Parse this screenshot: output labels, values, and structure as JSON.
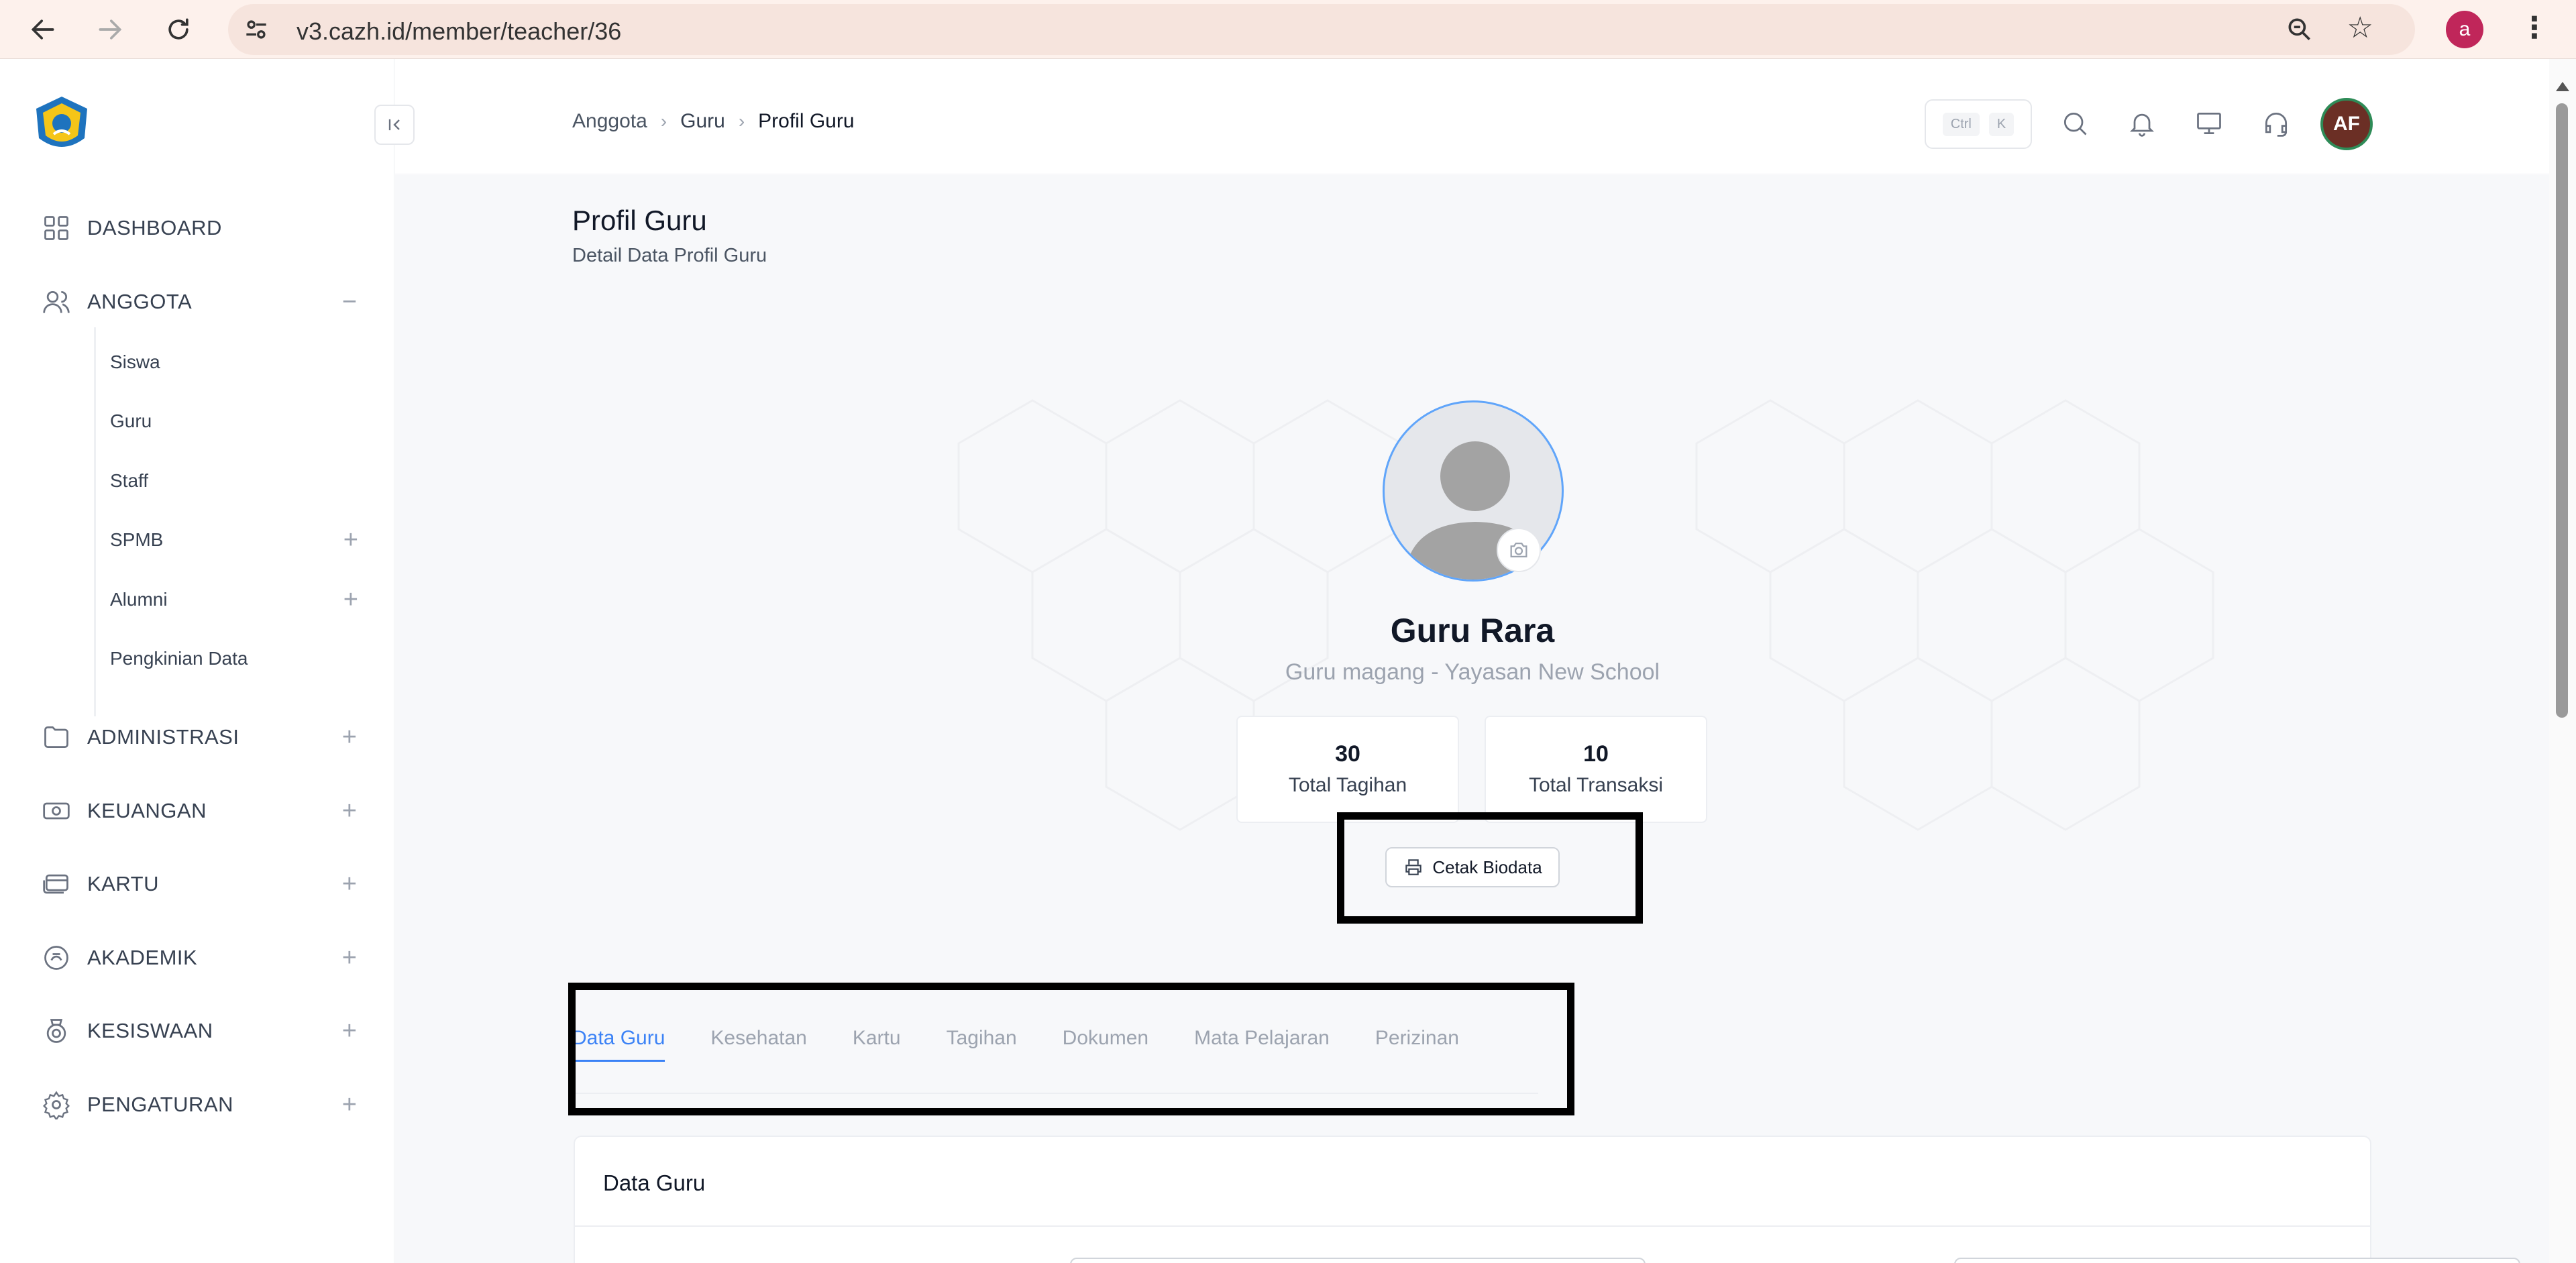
{
  "browser": {
    "url": "v3.cazh.id/member/teacher/36",
    "profile_initial": "a"
  },
  "sidebar": {
    "items": [
      {
        "label": "DASHBOARD",
        "icon": "grid-icon"
      },
      {
        "label": "ANGGOTA",
        "icon": "users-icon",
        "toggle": "−"
      },
      {
        "label": "ADMINISTRASI",
        "icon": "folder-icon",
        "toggle": "+"
      },
      {
        "label": "KEUANGAN",
        "icon": "cash-icon",
        "toggle": "+"
      },
      {
        "label": "KARTU",
        "icon": "card-icon",
        "toggle": "+"
      },
      {
        "label": "AKADEMIK",
        "icon": "academic-icon",
        "toggle": "+"
      },
      {
        "label": "KESISWAAN",
        "icon": "badge-icon",
        "toggle": "+"
      },
      {
        "label": "PENGATURAN",
        "icon": "gear-icon",
        "toggle": "+"
      }
    ],
    "sub_items": [
      {
        "label": "Siswa"
      },
      {
        "label": "Guru"
      },
      {
        "label": "Staff"
      },
      {
        "label": "SPMB",
        "toggle": "+"
      },
      {
        "label": "Alumni",
        "toggle": "+"
      },
      {
        "label": "Pengkinian Data"
      }
    ]
  },
  "header": {
    "breadcrumb": [
      "Anggota",
      "Guru",
      "Profil Guru"
    ],
    "shortcut": {
      "key1": "Ctrl",
      "key2": "K"
    },
    "avatar_initials": "AF"
  },
  "page": {
    "title": "Profil Guru",
    "subtitle": "Detail Data Profil Guru"
  },
  "profile": {
    "name": "Guru Rara",
    "role": "Guru magang - Yayasan New School",
    "stats": [
      {
        "value": "30",
        "label": "Total Tagihan"
      },
      {
        "value": "10",
        "label": "Total Transaksi"
      }
    ],
    "print_button": "Cetak Biodata"
  },
  "tabs": [
    "Data Guru",
    "Kesehatan",
    "Kartu",
    "Tagihan",
    "Dokumen",
    "Mata Pelajaran",
    "Perizinan"
  ],
  "active_tab": "Data Guru",
  "data_card": {
    "title": "Data Guru"
  },
  "colors": {
    "accent": "#3b82f6",
    "avatar_bg": "#6b2f25",
    "avatar_ring": "#2e8b57",
    "browser_profile": "#c0265a"
  }
}
